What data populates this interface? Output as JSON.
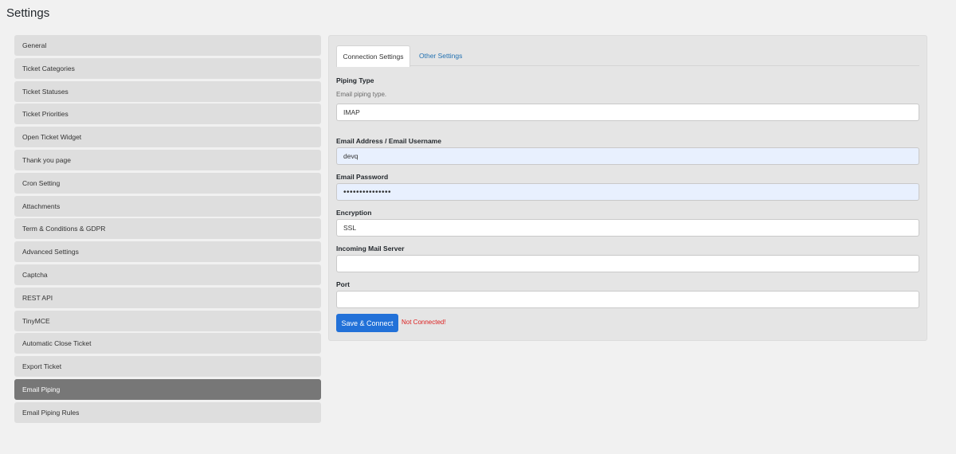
{
  "page": {
    "title": "Settings"
  },
  "sidebar": {
    "items": [
      {
        "label": "General"
      },
      {
        "label": "Ticket Categories"
      },
      {
        "label": "Ticket Statuses"
      },
      {
        "label": "Ticket Priorities"
      },
      {
        "label": "Open Ticket Widget"
      },
      {
        "label": "Thank you page"
      },
      {
        "label": "Cron Setting"
      },
      {
        "label": "Attachments"
      },
      {
        "label": "Term & Conditions & GDPR"
      },
      {
        "label": "Advanced Settings"
      },
      {
        "label": "Captcha"
      },
      {
        "label": "REST API"
      },
      {
        "label": "TinyMCE"
      },
      {
        "label": "Automatic Close Ticket"
      },
      {
        "label": "Export Ticket"
      },
      {
        "label": "Email Piping",
        "active": true
      },
      {
        "label": "Email Piping Rules"
      }
    ]
  },
  "tabs": {
    "connection": "Connection Settings",
    "other": "Other Settings"
  },
  "form": {
    "piping_type": {
      "label": "Piping Type",
      "description": "Email piping type.",
      "value": "IMAP"
    },
    "email": {
      "label": "Email Address / Email Username",
      "value": "devq"
    },
    "password": {
      "label": "Email Password",
      "value": "•••••••••••••••"
    },
    "encryption": {
      "label": "Encryption",
      "value": "SSL"
    },
    "server": {
      "label": "Incoming Mail Server",
      "value": ""
    },
    "port": {
      "label": "Port",
      "value": ""
    }
  },
  "actions": {
    "save_label": "Save & Connect",
    "status": "Not Connected!"
  },
  "colors": {
    "accent": "#2271d8",
    "active_item": "#777777",
    "error": "#dc1e1e",
    "link": "#2271b1"
  }
}
